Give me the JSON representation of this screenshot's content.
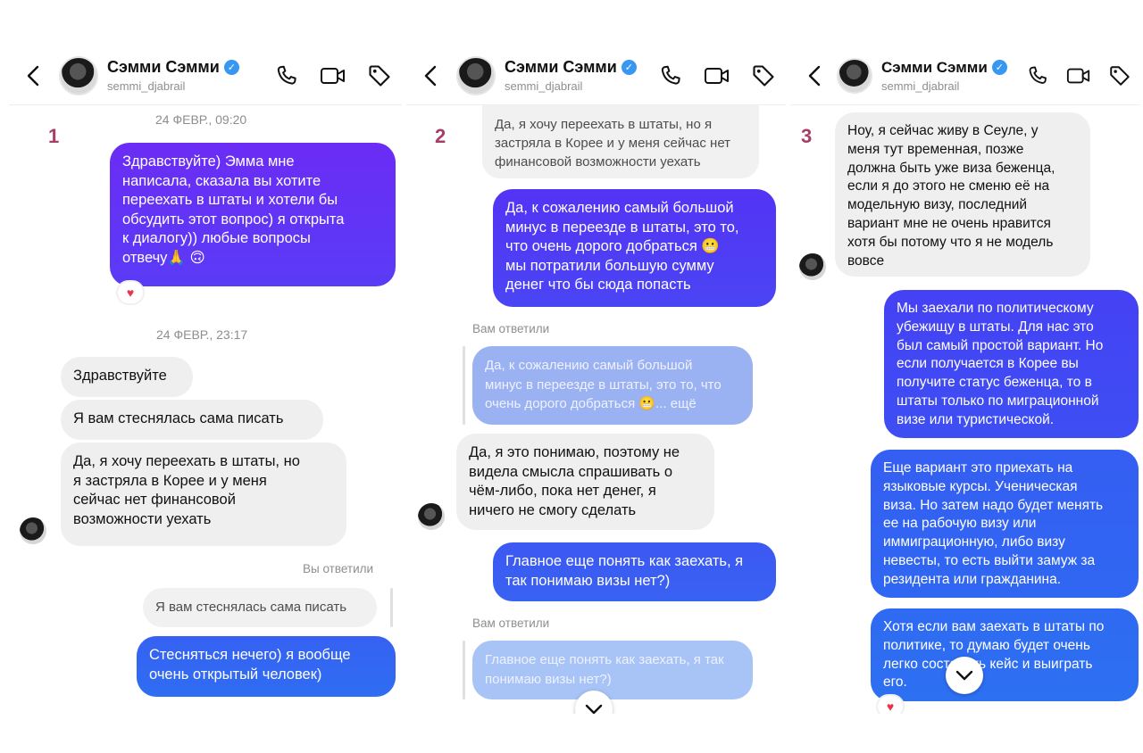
{
  "contact": {
    "name": "Сэмми Сэмми",
    "handle": "semmi_djabrail",
    "verified_mark": "✓"
  },
  "icons": [
    "back-arrow-icon",
    "phone-icon",
    "video-icon",
    "tag-icon",
    "heart-icon",
    "chevron-down-icon"
  ],
  "colors": {
    "gradient_top": "#6b2cf5",
    "gradient_bottom": "#2f6df2",
    "incoming_bubble": "#efefef",
    "number_label": "#a63f66"
  },
  "panels": [
    {
      "number": "1",
      "timestamp_1": "24 ФЕВР., 09:20",
      "msg_intro": "Здравствуйте) Эмма мне\nнаписала, сказала вы хотите\nпереехать в штаты и хотели бы\nобсудить этот вопрос) я открыта\nк диалогу)) любые вопросы\nотвечу🙏 🙃",
      "reaction": "♥",
      "timestamp_2": "24 ФЕВР., 23:17",
      "msg_hello": "Здравствуйте",
      "msg_shy": "Я вам стеснялась сама писать",
      "msg_want": "Да, я хочу переехать в штаты, но\nя застряла в Корее и у меня\nсейчас нет финансовой\nвозможности уехать",
      "you_replied": "Вы ответили",
      "quoted": "Я вам стеснялась сама писать",
      "msg_reply": "Стесняться нечего) я вообще\nочень открытый человек)"
    },
    {
      "number": "2",
      "msg_top_quote": "Да, я хочу переехать в штаты, но я\nзастряла в Корее и у меня сейчас нет\nфинансовой возможности уехать",
      "msg_expensive": "Да, к сожалению самый большой\nминус в переезде в штаты, это то,\nчто очень дорого добраться 😬\nмы потратили большую сумму\nденег что бы сюда попасть",
      "replied_to_you_1": "Вам ответили",
      "quoted_1": "Да, к сожалению самый большой\nминус в переезде в штаты, это то, что\nочень дорого добраться 😬... ещё",
      "msg_understand": "Да, я это понимаю, поэтому не\nвидела смысла спрашивать о\nчём-либо, пока нет денег, я\nничего не смогу сделать",
      "msg_question": "Главное еще понять как заехать, я\nтак понимаю визы нет?)",
      "replied_to_you_2": "Вам ответили",
      "quoted_2": "Главное еще понять как заехать, я так\nпонимаю визы нет?)"
    },
    {
      "number": "3",
      "msg_seoul": "Ноу, я сейчас живу в Сеуле, у\nменя тут временная, позже\nдолжна быть уже виза беженца,\nесли я до этого не сменю её на\nмодельную визу, последний\nвариант мне не очень нравится\nхотя бы потому что я не модель\nвовсе",
      "msg_political": "Мы заехали по политическому\nубежищу в штаты. Для нас это\nбыл самый простой вариант. Но\nесли получается в Корее вы\nполучите статус беженца, то в\nштаты только по миграционной\nвизе или туристической.",
      "msg_courses": "Еще вариант это приехать на\nязыковые курсы. Ученическая\nвиза. Но затем надо будет менять\nее на рабочую визу или\nиммиграционную, либо визу\nневесты, то есть выйти замуж за\nрезидента или гражданина.",
      "msg_politics": "Хотя если вам заехать в штаты по\nполитике, то думаю будет очень\nлегко составить кейс и выиграть\nего.",
      "reaction": "♥"
    }
  ]
}
